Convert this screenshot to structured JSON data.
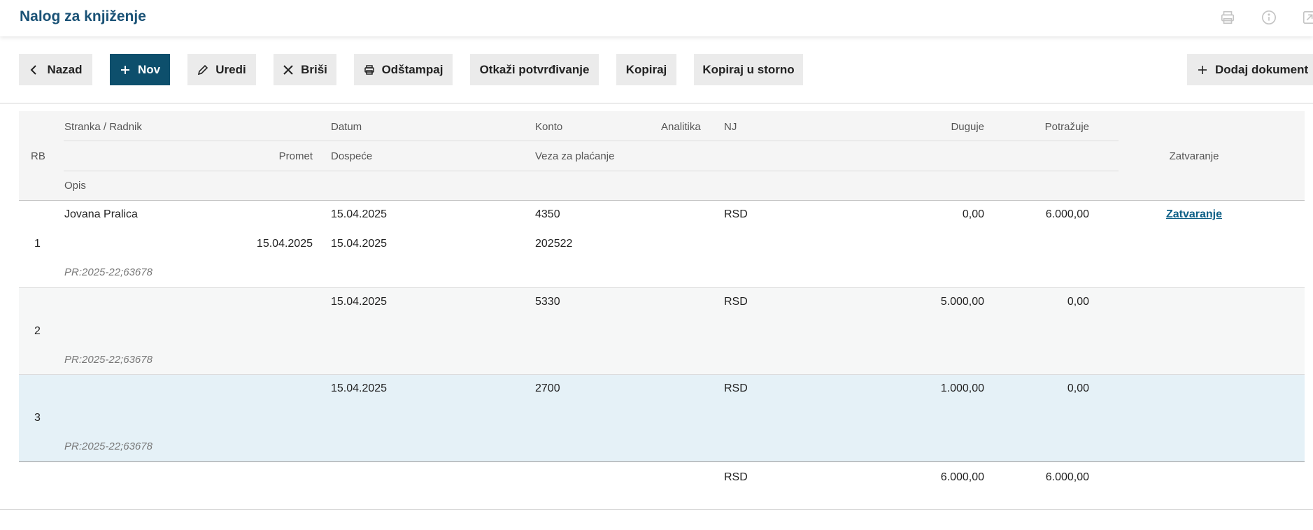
{
  "header": {
    "title": "Nalog za knjiženje",
    "icons": [
      "print-icon",
      "info-icon",
      "open-external-icon"
    ]
  },
  "toolbar": {
    "back": "Nazad",
    "new": "Nov",
    "edit": "Uredi",
    "delete": "Briši",
    "print": "Odštampaj",
    "cancel_confirm": "Otkaži potvrđivanje",
    "copy": "Kopiraj",
    "copy_storno": "Kopiraj u storno",
    "add_document": "Dodaj dokument"
  },
  "table": {
    "headers": {
      "rb": "RB",
      "stranka": "Stranka / Radnik",
      "promet": "Promet",
      "opis": "Opis",
      "datum": "Datum",
      "dospece": "Dospeće",
      "konto": "Konto",
      "veza": "Veza za plaćanje",
      "analitika": "Analitika",
      "nj": "NJ",
      "duguje": "Duguje",
      "potrazuje": "Potražuje",
      "zatvaranje": "Zatvaranje"
    },
    "rows": [
      {
        "rb": "1",
        "stranka": "Jovana Pralica",
        "promet": "15.04.2025",
        "datum": "15.04.2025",
        "dospece": "15.04.2025",
        "konto": "4350",
        "veza": "202522",
        "nj": "RSD",
        "duguje": "0,00",
        "potrazuje": "6.000,00",
        "zatvaranje": "Zatvaranje",
        "opis": "PR:2025-22;63678"
      },
      {
        "rb": "2",
        "stranka": "",
        "promet": "",
        "datum": "15.04.2025",
        "dospece": "",
        "konto": "5330",
        "veza": "",
        "nj": "RSD",
        "duguje": "5.000,00",
        "potrazuje": "0,00",
        "zatvaranje": "",
        "opis": "PR:2025-22;63678"
      },
      {
        "rb": "3",
        "stranka": "",
        "promet": "",
        "datum": "15.04.2025",
        "dospece": "",
        "konto": "2700",
        "veza": "",
        "nj": "RSD",
        "duguje": "1.000,00",
        "potrazuje": "0,00",
        "zatvaranje": "",
        "opis": "PR:2025-22;63678"
      }
    ],
    "totals": {
      "nj": "RSD",
      "duguje": "6.000,00",
      "potrazuje": "6.000,00"
    }
  },
  "colors": {
    "title": "#1a5276",
    "primary_button": "#0d4f6c",
    "link": "#0d5f86",
    "selected_row": "#e5f1f7"
  }
}
